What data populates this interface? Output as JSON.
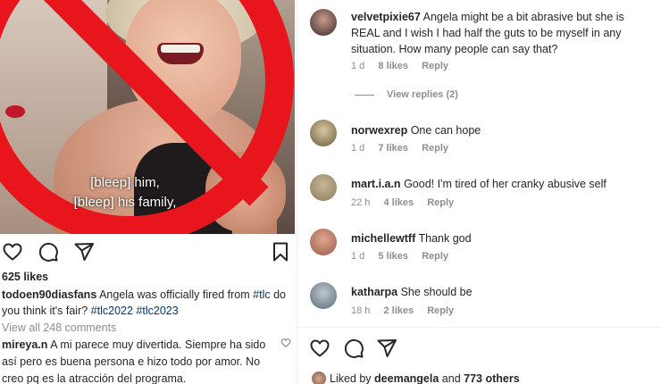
{
  "post": {
    "caption_overlay": [
      "[bleep] him,",
      "[bleep] his family,"
    ],
    "likes": "625 likes",
    "author": "todoen90diasfans",
    "caption_pre": "Angela was officially fired from",
    "tag_tlc": "#tlc",
    "caption_mid": "do you think it's fair?",
    "tag_2022": "#tlc2022",
    "tag_2023": "#tlc2023",
    "view_all": "View all 248 comments",
    "first_comment_user": "mireya.n",
    "first_comment_text": "A mi parece muy divertida. Siempre ha sido así pero es buena persona e hizo todo por amor. No creo pq es la atracción del programa."
  },
  "comments": [
    {
      "user": "velvetpixie67",
      "text": "Angela might be a bit abrasive but she is REAL and I wish I had half the guts to be myself in any situation. How many people can say that?",
      "time": "1 d",
      "likes": "8 likes",
      "reply": "Reply",
      "avatar_color": "#3a2a2e"
    },
    {
      "user": "norwexrep",
      "text": "One can hope",
      "time": "1 d",
      "likes": "7 likes",
      "reply": "Reply",
      "avatar_color": "#6b5a3e"
    },
    {
      "user": "mart.i.a.n",
      "text": "Good! I'm tired of her cranky abusive self",
      "time": "22 h",
      "likes": "4 likes",
      "reply": "Reply",
      "avatar_color": "#8a7a5a"
    },
    {
      "user": "michellewtff",
      "text": "Thank god",
      "time": "1 d",
      "likes": "5 likes",
      "reply": "Reply",
      "avatar_color": "#9a5a4a"
    },
    {
      "user": "katharpa",
      "text": "She should be",
      "time": "18 h",
      "likes": "2 likes",
      "reply": "Reply",
      "avatar_color": "#5a6a7a"
    }
  ],
  "view_replies": "View replies (2)",
  "liked_by": {
    "prefix": "Liked by",
    "user": "deemangela",
    "middle": "and",
    "others": "773 others"
  },
  "icons": {
    "like": "heart-icon",
    "comment": "comment-icon",
    "share": "share-icon",
    "save": "bookmark-icon"
  },
  "colors": {
    "text": "#262626",
    "muted": "#8e8e8e",
    "hashtag": "#00376b",
    "ban_red": "#e8161c"
  }
}
